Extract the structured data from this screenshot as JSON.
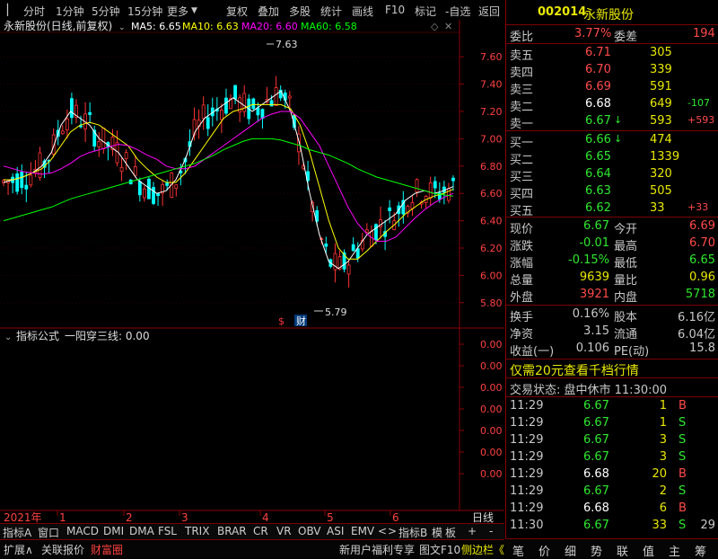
{
  "toolbar": {
    "items": [
      "分时",
      "1分钟",
      "5分钟",
      "15分钟",
      "更多",
      "复权",
      "叠加",
      "多股",
      "统计",
      "画线",
      "F10",
      "标记",
      "-自选",
      "返回"
    ]
  },
  "chart": {
    "title": "永新股份(日线,前复权)",
    "ma5": "MA5: 6.65",
    "ma10": "MA10: 6.63",
    "ma20": "MA20: 6.60",
    "ma60": "MA60: 6.58",
    "high_marker": "7.63",
    "low_marker": "5.79",
    "money_icon_label": "$",
    "finance_label": "财",
    "yaxis_ticks": [
      "7.60",
      "7.40",
      "7.20",
      "7.00",
      "6.80",
      "6.60",
      "6.40",
      "6.20",
      "6.00",
      "5.80"
    ],
    "indicator_label": "指标公式",
    "indicator_value": "一阳穿三线: 0.00",
    "indicator_ticks": [
      "0.00",
      "0.00",
      "0.00",
      "0.00",
      "0.00",
      "0.00",
      "0.00"
    ],
    "x_year": "2021年",
    "x_months": [
      "1",
      "2",
      "3",
      "4",
      "5",
      "6"
    ],
    "period_label": "日线",
    "colors": {
      "up": "#ff3333",
      "down": "#00ffff",
      "ma5": "#ffffff",
      "ma10": "#ffff00",
      "ma20": "#ff00ff",
      "ma60": "#00ff00"
    }
  },
  "chart_data": {
    "type": "candlestick",
    "title": "永新股份(日线,前复权)",
    "ylim": [
      5.7,
      7.7
    ],
    "series": [
      {
        "name": "MA5",
        "values": [
          6.68,
          6.7,
          6.72,
          6.75,
          6.8,
          6.9,
          7.1,
          7.2,
          7.15,
          7.1,
          7.0,
          6.95,
          6.9,
          6.8,
          6.7,
          6.65,
          6.6,
          6.62,
          6.7,
          6.85,
          7.05,
          7.15,
          7.2,
          7.25,
          7.3,
          7.25,
          7.2,
          7.25,
          7.3,
          7.35,
          7.2,
          6.95,
          6.6,
          6.3,
          6.1,
          6.05,
          6.1,
          6.2,
          6.3,
          6.35,
          6.4,
          6.45,
          6.55,
          6.6,
          6.62,
          6.6,
          6.62,
          6.65
        ]
      },
      {
        "name": "MA10",
        "values": [
          6.7,
          6.7,
          6.72,
          6.75,
          6.78,
          6.85,
          6.95,
          7.05,
          7.1,
          7.12,
          7.1,
          7.05,
          7.0,
          6.95,
          6.85,
          6.78,
          6.72,
          6.68,
          6.68,
          6.75,
          6.85,
          6.95,
          7.05,
          7.15,
          7.2,
          7.22,
          7.25,
          7.25,
          7.25,
          7.25,
          7.22,
          7.1,
          6.9,
          6.65,
          6.4,
          6.2,
          6.12,
          6.12,
          6.18,
          6.25,
          6.32,
          6.38,
          6.45,
          6.5,
          6.55,
          6.58,
          6.6,
          6.63
        ]
      },
      {
        "name": "MA20",
        "values": [
          6.8,
          6.78,
          6.76,
          6.75,
          6.74,
          6.75,
          6.78,
          6.82,
          6.87,
          6.9,
          6.92,
          6.94,
          6.96,
          6.95,
          6.92,
          6.88,
          6.85,
          6.8,
          6.78,
          6.78,
          6.8,
          6.85,
          6.9,
          6.95,
          7.0,
          7.05,
          7.1,
          7.15,
          7.18,
          7.2,
          7.2,
          7.15,
          7.05,
          6.95,
          6.8,
          6.65,
          6.5,
          6.38,
          6.3,
          6.25,
          6.25,
          6.28,
          6.35,
          6.42,
          6.48,
          6.53,
          6.57,
          6.6
        ]
      },
      {
        "name": "MA60",
        "values": [
          6.4,
          6.42,
          6.44,
          6.46,
          6.48,
          6.5,
          6.53,
          6.56,
          6.58,
          6.6,
          6.62,
          6.64,
          6.66,
          6.68,
          6.7,
          6.72,
          6.74,
          6.76,
          6.78,
          6.8,
          6.82,
          6.85,
          6.88,
          6.92,
          6.95,
          6.98,
          7.0,
          7.0,
          7.0,
          6.99,
          6.97,
          6.95,
          6.92,
          6.9,
          6.88,
          6.85,
          6.82,
          6.78,
          6.75,
          6.72,
          6.7,
          6.68,
          6.66,
          6.64,
          6.62,
          6.6,
          6.59,
          6.58
        ]
      }
    ]
  },
  "quote": {
    "code": "002014",
    "name": "永新股份",
    "weibi_label": "委比",
    "weibi": "3.77%",
    "weicha_label": "委差",
    "weicha": "194",
    "asks": [
      {
        "label": "卖五",
        "price": "6.71",
        "vol": "305",
        "chg": ""
      },
      {
        "label": "卖四",
        "price": "6.70",
        "vol": "339",
        "chg": ""
      },
      {
        "label": "卖三",
        "price": "6.69",
        "vol": "591",
        "chg": ""
      },
      {
        "label": "卖二",
        "price": "6.68",
        "vol": "649",
        "chg": "-107"
      },
      {
        "label": "卖一",
        "price": "6.67",
        "vol": "593",
        "chg": "+593"
      }
    ],
    "bids": [
      {
        "label": "买一",
        "price": "6.66",
        "vol": "474",
        "chg": ""
      },
      {
        "label": "买二",
        "price": "6.65",
        "vol": "1339",
        "chg": ""
      },
      {
        "label": "买三",
        "price": "6.64",
        "vol": "320",
        "chg": ""
      },
      {
        "label": "买四",
        "price": "6.63",
        "vol": "505",
        "chg": ""
      },
      {
        "label": "买五",
        "price": "6.62",
        "vol": "33",
        "chg": "+33"
      }
    ],
    "stats": [
      {
        "l1": "现价",
        "v1": "6.67",
        "l2": "今开",
        "v2": "6.69"
      },
      {
        "l1": "涨跌",
        "v1": "-0.01",
        "l2": "最高",
        "v2": "6.70"
      },
      {
        "l1": "涨幅",
        "v1": "-0.15%",
        "l2": "最低",
        "v2": "6.65"
      },
      {
        "l1": "总量",
        "v1": "9639",
        "l2": "量比",
        "v2": "0.96"
      },
      {
        "l1": "外盘",
        "v1": "3921",
        "l2": "内盘",
        "v2": "5718"
      }
    ],
    "fund": [
      {
        "l1": "换手",
        "v1": "0.16%",
        "l2": "股本",
        "v2": "6.16亿"
      },
      {
        "l1": "净资",
        "v1": "3.15",
        "l2": "流通",
        "v2": "6.04亿"
      },
      {
        "l1": "收益(一)",
        "v1": "0.106",
        "l2": "PE(动)",
        "v2": "15.8"
      }
    ],
    "promo": "仅需20元查看千档行情",
    "trade_status": "交易状态: 盘中休市 11:30:00",
    "ticks": [
      {
        "t": "11:29",
        "p": "6.67",
        "v": "1",
        "s": "B"
      },
      {
        "t": "11:29",
        "p": "6.67",
        "v": "1",
        "s": "S"
      },
      {
        "t": "11:29",
        "p": "6.67",
        "v": "3",
        "s": "S"
      },
      {
        "t": "11:29",
        "p": "6.67",
        "v": "3",
        "s": "S"
      },
      {
        "t": "11:29",
        "p": "6.68",
        "v": "20",
        "s": "B"
      },
      {
        "t": "11:29",
        "p": "6.67",
        "v": "2",
        "s": "S"
      },
      {
        "t": "11:29",
        "p": "6.68",
        "v": "6",
        "s": "B"
      },
      {
        "t": "11:30",
        "p": "6.67",
        "v": "33",
        "s": "S"
      }
    ],
    "tick_extra": "29"
  },
  "bottom_tabs": {
    "row1": [
      "指标A",
      "窗口",
      "MACD",
      "DMI",
      "DMA",
      "FSL",
      "TRIX",
      "BRAR",
      "CR",
      "VR",
      "OBV",
      "ASI",
      "EMV",
      "<",
      ">",
      "指标B",
      "模",
      "板",
      "+",
      "-"
    ],
    "row2_left": [
      "扩展∧",
      "关联报价",
      "财富圈"
    ],
    "row2_right": [
      "新用户福利专享",
      "图文F10",
      "侧边栏《"
    ],
    "right_tabs": [
      "笔",
      "价",
      "细",
      "势",
      "联",
      "值",
      "主",
      "筹"
    ]
  }
}
